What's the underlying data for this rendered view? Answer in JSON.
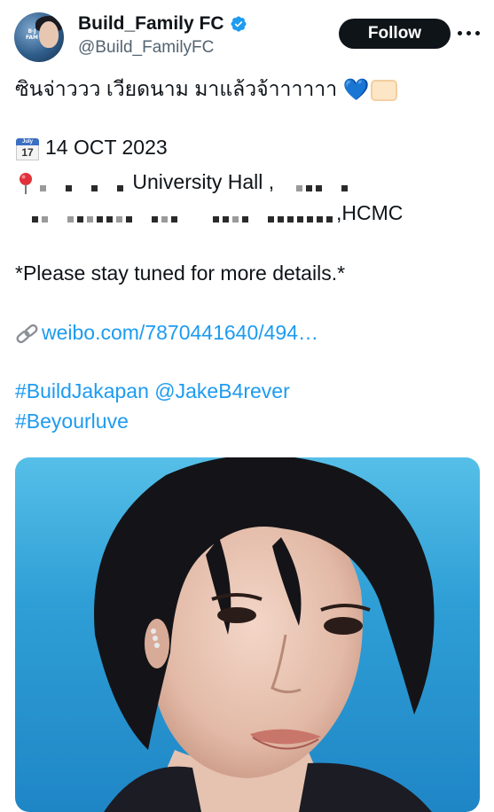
{
  "account": {
    "display_name": "Build_Family FC",
    "handle": "@Build_FamilyFC",
    "avatar_text": "BUILD JAKAPAN Family"
  },
  "follow_button": {
    "label": "Follow"
  },
  "tweet": {
    "thai_line": "ซินจ่าววว เวียดนาม มาแล้วจ้าาาาาา",
    "calendar_month": "July",
    "calendar_day": "17",
    "date": "14 OCT 2023",
    "venue_suffix": "University Hall ,",
    "address_suffix": ",HCMC",
    "stay_tuned": "*Please stay tuned for more details.*",
    "link": "weibo.com/7870441640/494…",
    "hashtag_1": "#BuildJakapan",
    "mention": "@JakeB4rever",
    "hashtag_2": "#Beyourluve"
  },
  "icons": {
    "verified": "verified-badge-icon",
    "more": "more-options-icon",
    "calendar": "calendar-icon",
    "pin": "round-pushpin-icon",
    "link": "link-icon",
    "heart": "blue-heart-icon",
    "heart_hands": "heart-hands-icon"
  },
  "colors": {
    "link": "#1d9bf0",
    "follow_bg": "#0f1419",
    "verified": "#1d9bf0",
    "handle": "#536471"
  }
}
